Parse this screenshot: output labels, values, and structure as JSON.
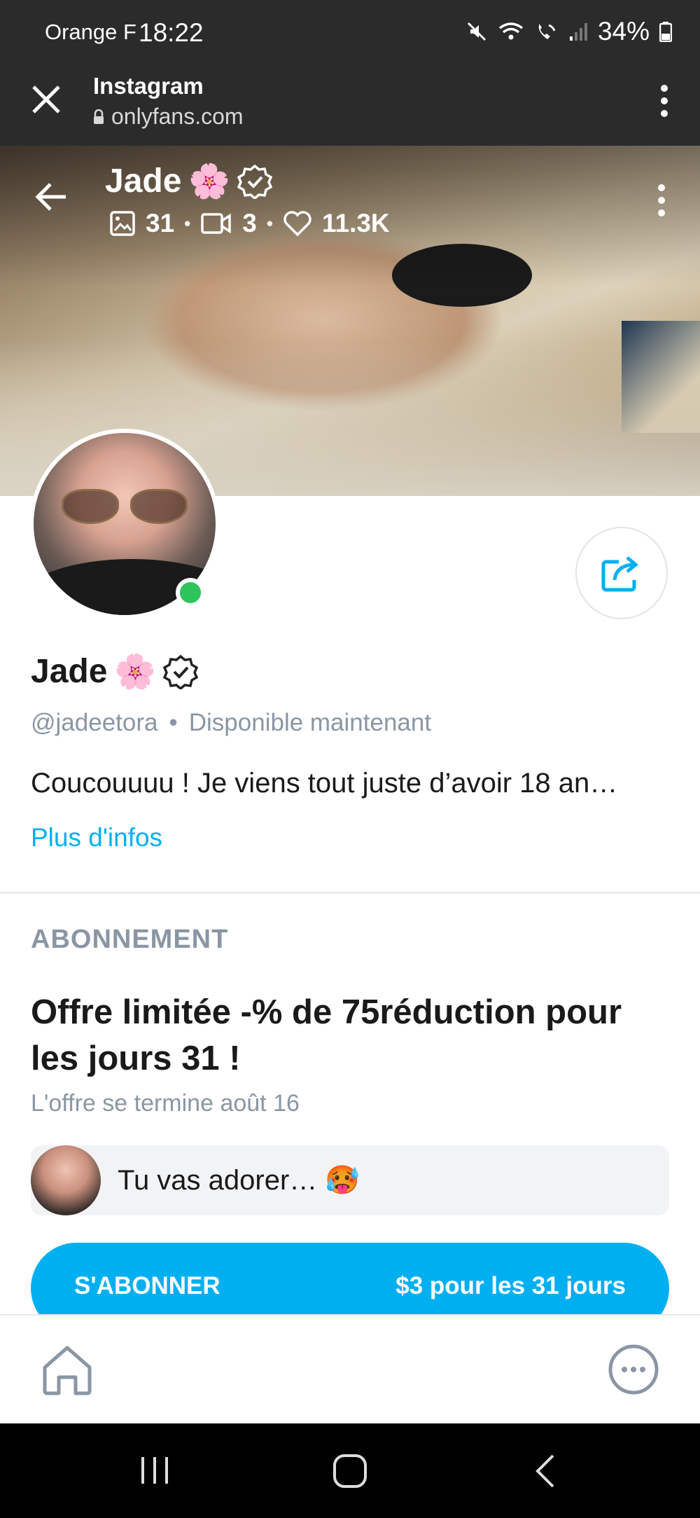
{
  "status_bar": {
    "carrier": "Orange F",
    "time": "18:22",
    "battery": "34%"
  },
  "browser": {
    "title": "Instagram",
    "url": "onlyfans.com"
  },
  "cover": {
    "name": "Jade",
    "emoji": "🌸",
    "photos_count": "31",
    "videos_count": "3",
    "likes_count": "11.3K"
  },
  "profile": {
    "name": "Jade",
    "emoji": "🌸",
    "handle": "@jadeetora",
    "separator": "•",
    "availability": "Disponible maintenant",
    "bio": "Coucouuuu ! Je viens tout juste d’avoir 18 an…",
    "more_link": "Plus d'infos"
  },
  "subscription": {
    "section_title": "ABONNEMENT",
    "offer_title": "Offre limitée -% de 75réduction pour les jours 31 !",
    "offer_ends": "L'offre se termine août 16",
    "message": "Tu vas adorer… 🥵",
    "button_left": "S'ABONNER",
    "button_right": "$3 pour les 31 jours"
  },
  "colors": {
    "accent": "#00aff0",
    "online": "#2ec45c",
    "muted": "#8a96a3"
  },
  "icons": {
    "close": "close-icon",
    "lock": "lock-icon",
    "menu": "kebab-menu-icon",
    "back": "back-arrow-icon",
    "verified": "verified-badge-icon",
    "photo": "image-icon",
    "video": "video-icon",
    "heart": "heart-icon",
    "share": "share-icon",
    "home": "home-icon",
    "chat": "chat-bubble-icon"
  }
}
